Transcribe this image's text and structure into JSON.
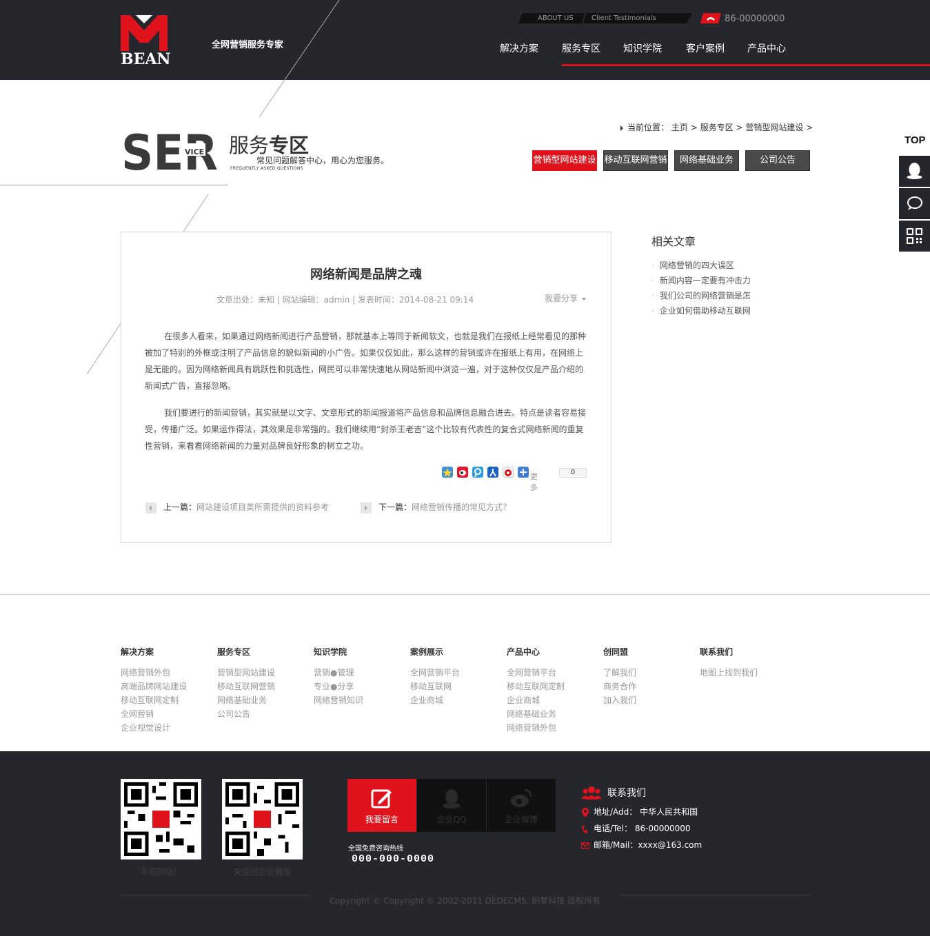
{
  "header": {
    "logo_text": "BEAN",
    "slogan": "全网营销服务专家",
    "top_links": [
      "ABOUT US",
      "Client Testimonials"
    ],
    "phone": "86-00000000",
    "nav": [
      "解决方案",
      "服务专区",
      "知识学院",
      "客户案例",
      "产品中心"
    ],
    "active_nav": "服务专区"
  },
  "banner": {
    "ser_big": "SER",
    "ser_small": "VICE",
    "title_light": "服务",
    "title_bold": "专区",
    "subtitle": "常见问题解答中心，用心为您服务。",
    "english": "FREQUENTLY ASKED QUESTIONS"
  },
  "breadcrumb": {
    "prefix": "当前位置：",
    "items": [
      "主页",
      "服务专区",
      "营销型网站建设"
    ],
    "sep": ">"
  },
  "tabs": [
    "营销型网站建设",
    "移动互联网营销",
    "网络基础业务",
    "公司公告"
  ],
  "side": {
    "top_label": "TOP"
  },
  "article": {
    "title": "网络新闻是品牌之魂",
    "meta": "文章出处：未知 | 网站编辑：admin | 发表时间：2014-08-21 09:14",
    "share_label": "我要分享",
    "paragraphs": [
      "在很多人看来，如果通过网络新闻进行产品营销，那就基本上等同于新闻软文，也就是我们在报纸上经常看见的那种被加了特别的外框或注明了产品信息的貌似新闻的小广告。如果仅仅如此，那么这样的营销或许在报纸上有用，在网络上是无能的。因为网络新闻具有跳跃性和挑选性，网民可以非常快速地从网站新闻中浏览一遍，对于这种仅仅是产品介绍的新闻式广告，直接忽略。",
      "我们要进行的新闻营销，其实就是以文字、文章形式的新闻报道将产品信息和品牌信息融合进去。特点是读者容易接受，传播广泛。如果运作得法，其效果是非常强的。我们继续用“封杀王老吉”这个比较有代表性的复合式网络新闻的重复性营销，来看看网络新闻的力量对品牌良好形象的树立之功。"
    ],
    "share_more": "更多",
    "share_count": "0",
    "prev_label": "上一篇：",
    "prev_title": "网站建设项目类所需提供的资料参考",
    "next_label": "下一篇：",
    "next_title": "网络营销传播的常见方式？"
  },
  "related": {
    "title": "相关文章",
    "items": [
      "网络营销的四大误区",
      "新闻内容一定要有冲击力",
      "我们公司的网络营销是怎",
      "企业如何借助移动互联网"
    ]
  },
  "footer_links": [
    {
      "title": "解决方案",
      "items": [
        "网络营销外包",
        "高端品牌网站建设",
        "移动互联网定制",
        "全网营销",
        "企业视觉设计"
      ]
    },
    {
      "title": "服务专区",
      "items": [
        "营销型网站建设",
        "移动互联网营销",
        "网络基础业务",
        "公司公告"
      ]
    },
    {
      "title": "知识学院",
      "items": [
        "营销●管理",
        "专业●分享",
        "网络营销知识"
      ]
    },
    {
      "title": "案例展示",
      "items": [
        "全网营销平台",
        "移动互联网",
        "企业商城"
      ]
    },
    {
      "title": "产品中心",
      "items": [
        "全网营销平台",
        "移动互联网定制",
        "企业商城",
        "网络基础业务",
        "网络营销外包"
      ]
    },
    {
      "title": "创同盟",
      "items": [
        "了解我们",
        "商务合作",
        "加入我们"
      ]
    },
    {
      "title": "联系我们",
      "items": [
        "地图上找到我们"
      ]
    }
  ],
  "bottom": {
    "qr_captions": [
      "手机网站！",
      "关注创企业微信"
    ],
    "buttons": [
      "我要留言",
      "企业QQ",
      "企业微博"
    ],
    "hotline_label": "全国免费咨询热线",
    "hotline": "000-000-0000",
    "contact_title": "联系我们",
    "address": "地址/Add： 中华人民共和国",
    "tel": "电话/Tel： 86-00000000",
    "mail": "邮箱/Mail：xxxx@163.com",
    "copyright": "Copyright © Copyright © 2002-2011 DEDECMS. 织梦科技 版权所有"
  },
  "colors": {
    "accent": "#e0121b",
    "dark": "#26272c"
  }
}
